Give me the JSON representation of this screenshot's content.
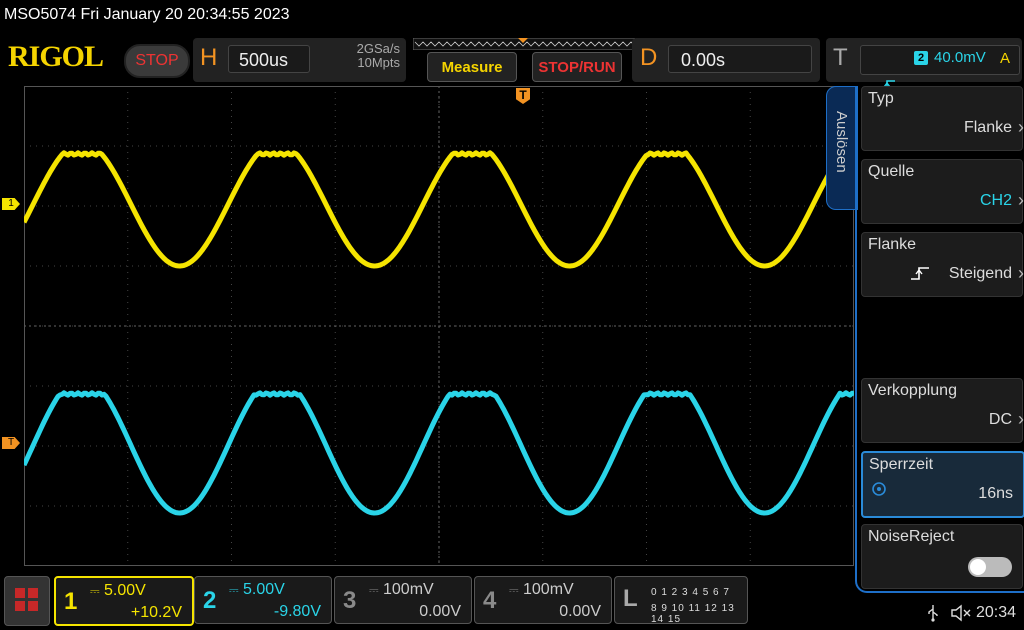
{
  "title_bar": {
    "text": "MSO5074  Fri January 20 20:34:55 2023"
  },
  "header": {
    "logo": "RIGOL",
    "run_state": "STOP",
    "horizontal": {
      "letter": "H",
      "timebase": "500us",
      "sample_rate": "2GSa/s",
      "memory_depth": "10Mpts"
    },
    "measure_label": "Measure",
    "stoprun_label": "STOP/RUN",
    "delay": {
      "letter": "D",
      "value": "0.00s"
    },
    "trigger": {
      "letter": "T",
      "source": "2",
      "level": "40.0mV",
      "mode": "A"
    }
  },
  "trigger_position_marker": "T",
  "channel_markers": {
    "ch1": "1",
    "ch2": "T"
  },
  "side_menu": {
    "tab_label": "Auslösen",
    "items": [
      {
        "label": "Typ",
        "value": "Flanke"
      },
      {
        "label": "Quelle",
        "value": "CH2"
      },
      {
        "label": "Flanke",
        "value": "Steigend"
      },
      {
        "label": "Verkopplung",
        "value": "DC"
      },
      {
        "label": "Sperrzeit",
        "value": "16ns"
      },
      {
        "label": "NoiseReject",
        "value": ""
      }
    ],
    "noise_reject_enabled": false
  },
  "bottom_bar": {
    "channels": [
      {
        "num": "1",
        "scale": "5.00V",
        "offset": "+10.2V",
        "color": "#f5e400",
        "active": true
      },
      {
        "num": "2",
        "scale": "5.00V",
        "offset": "-9.80V",
        "color": "#2ad4e8",
        "active": true
      },
      {
        "num": "3",
        "scale": "100mV",
        "offset": "0.00V",
        "color": "#8a8a8a",
        "active": false
      },
      {
        "num": "4",
        "scale": "100mV",
        "offset": "0.00V",
        "color": "#8a8a8a",
        "active": false
      }
    ],
    "logic": {
      "num": "L",
      "row1": "0 1 2 3   4 5 6 7",
      "row2": "8 9 10 11 12 13 14 15"
    },
    "time": "20:34"
  },
  "colors": {
    "ch1": "#f5e400",
    "ch2": "#2ad4e8",
    "accent": "#1e6fc8",
    "orange": "#f39322"
  }
}
